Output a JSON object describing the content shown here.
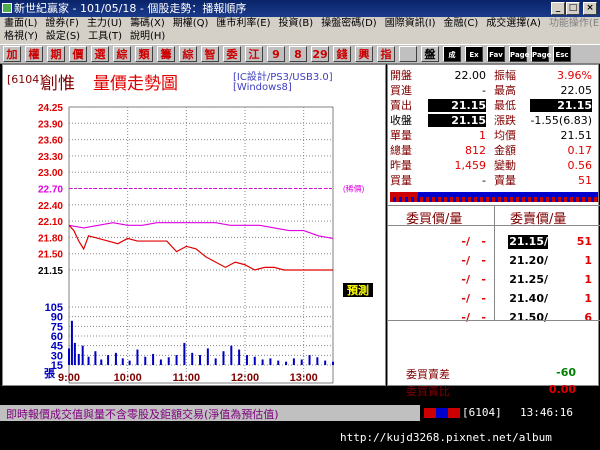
{
  "titlebar": {
    "title": "新世紀贏家 - 101/05/18 - 個股走勢：播報順序"
  },
  "menu": {
    "row1": [
      "畫面(L)",
      "證券(F)",
      "主力(U)",
      "籌碼(X)",
      "期權(Q)",
      "匯市利率(E)",
      "投資(B)",
      "操盤密碼(D)",
      "國際資訊(I)",
      "金融(C)",
      "成交選擇(A)",
      "功能操作(E)"
    ],
    "row2": [
      "格視(Y)",
      "設定(S)",
      "工具(T)",
      "說明(H)"
    ]
  },
  "toolbar": {
    "buttons": [
      "加",
      "權",
      "期",
      "價",
      "選",
      "綜",
      "類",
      "籌",
      "綜",
      "智",
      "委",
      "江",
      "9",
      "8",
      "29",
      "錢",
      "興",
      "指",
      "",
      "盤",
      "成",
      "Ex",
      "Fav",
      "Page",
      "Page",
      "Esc"
    ]
  },
  "chart": {
    "code": "6104",
    "name": "創惟",
    "title": "量價走勢圖",
    "tag1": "[IC設計/PS3/USB3.0]",
    "tag2": "[Windows8]",
    "ref_label": "(稀價)",
    "note": "預測",
    "vol_unit": "張",
    "price_ticks": [
      "24.25",
      "23.90",
      "23.60",
      "23.30",
      "23.00",
      "22.70",
      "22.40",
      "22.10",
      "21.80",
      "21.50",
      "21.15"
    ],
    "vol_ticks": [
      "105",
      "90",
      "75",
      "60",
      "45",
      "30",
      "15"
    ],
    "time_ticks": [
      "9:00",
      "10:00",
      "11:00",
      "12:00",
      "13:00"
    ]
  },
  "quote": {
    "rows": [
      {
        "k1": "開盤",
        "v1": "22.00",
        "k2": "振幅",
        "v2": "3.96%"
      },
      {
        "k1": "買進",
        "v1": "-",
        "k2": "最高",
        "v2": "22.05"
      },
      {
        "k1": "賣出",
        "v1": "21.15",
        "k2": "最低",
        "v2": "21.15"
      },
      {
        "k1": "收盤",
        "v1": "21.15",
        "k2": "漲跌",
        "v2": "-1.55(6.83)"
      },
      {
        "k1": "單量",
        "v1": "1",
        "k2": "均價",
        "v2": "21.51"
      },
      {
        "k1": "總量",
        "v1": "812",
        "k2": "金額",
        "v2": "0.17"
      },
      {
        "k1": "昨量",
        "v1": "1,459",
        "k2": "變動",
        "v2": "0.56"
      },
      {
        "k1": "買量",
        "v1": "-",
        "k2": "賣量",
        "v2": "51"
      }
    ]
  },
  "orderbook": {
    "bid_header": "委買價/量",
    "ask_header": "委賣價/量",
    "rows": [
      {
        "bp": "-/",
        "bq": "-",
        "ap": "21.15/",
        "aq": "51"
      },
      {
        "bp": "-/",
        "bq": "-",
        "ap": "21.20/",
        "aq": "1"
      },
      {
        "bp": "-/",
        "bq": "-",
        "ap": "21.25/",
        "aq": "1"
      },
      {
        "bp": "-/",
        "bq": "-",
        "ap": "21.40/",
        "aq": "1"
      },
      {
        "bp": "-/",
        "bq": "-",
        "ap": "21.50/",
        "aq": "6"
      }
    ],
    "diff_label": "委買賣差",
    "diff_value": "-60",
    "ratio_label": "委買賣比",
    "ratio_value": "0.00"
  },
  "status": {
    "message": "即時報價成交值與量不含零股及鉅額交易(淨值為預估值)",
    "code": "6104",
    "time": "13:46:16"
  },
  "watermark": "http://kujd3268.pixnet.net/album",
  "chart_data": {
    "type": "line",
    "ylim": [
      21.15,
      24.25
    ],
    "x_range": [
      "9:00",
      "13:30"
    ],
    "series": [
      {
        "values_minutes": [
          0,
          5,
          10,
          15,
          20,
          30,
          40,
          50,
          60,
          70,
          80,
          90,
          100,
          110,
          120,
          130,
          140,
          150,
          160,
          170,
          180,
          190,
          200,
          210,
          220,
          230,
          240,
          250,
          260,
          270
        ],
        "values": [
          22.0,
          21.9,
          21.7,
          21.55,
          21.8,
          21.75,
          21.7,
          21.65,
          21.75,
          21.7,
          21.7,
          21.7,
          21.7,
          21.5,
          21.6,
          21.55,
          21.4,
          21.3,
          21.2,
          21.3,
          21.25,
          21.15,
          21.2,
          21.2,
          21.15,
          21.15,
          21.15,
          21.15,
          21.15,
          21.15
        ]
      },
      {
        "values_minutes": [
          0,
          15,
          30,
          45,
          60,
          75,
          90,
          105,
          120,
          135,
          150,
          165,
          180,
          195,
          210,
          225,
          240,
          255,
          270
        ],
        "values": [
          22.0,
          21.95,
          22.0,
          22.05,
          22.0,
          22.0,
          22.05,
          22.05,
          22.05,
          22.05,
          22.05,
          22.0,
          22.0,
          22.0,
          21.95,
          21.9,
          21.9,
          21.8,
          21.75
        ]
      }
    ],
    "volume_minutes": [
      0,
      3,
      6,
      10,
      14,
      20,
      27,
      33,
      40,
      48,
      55,
      62,
      70,
      78,
      86,
      94,
      102,
      110,
      118,
      126,
      134,
      142,
      150,
      158,
      166,
      174,
      182,
      190,
      198,
      206,
      214,
      222,
      230,
      238,
      246,
      254,
      262,
      270
    ],
    "volume": [
      30,
      80,
      40,
      20,
      35,
      15,
      25,
      10,
      18,
      22,
      12,
      8,
      28,
      15,
      20,
      10,
      14,
      18,
      40,
      22,
      18,
      30,
      12,
      25,
      35,
      28,
      18,
      15,
      10,
      12,
      8,
      6,
      12,
      10,
      18,
      14,
      8,
      6
    ]
  }
}
